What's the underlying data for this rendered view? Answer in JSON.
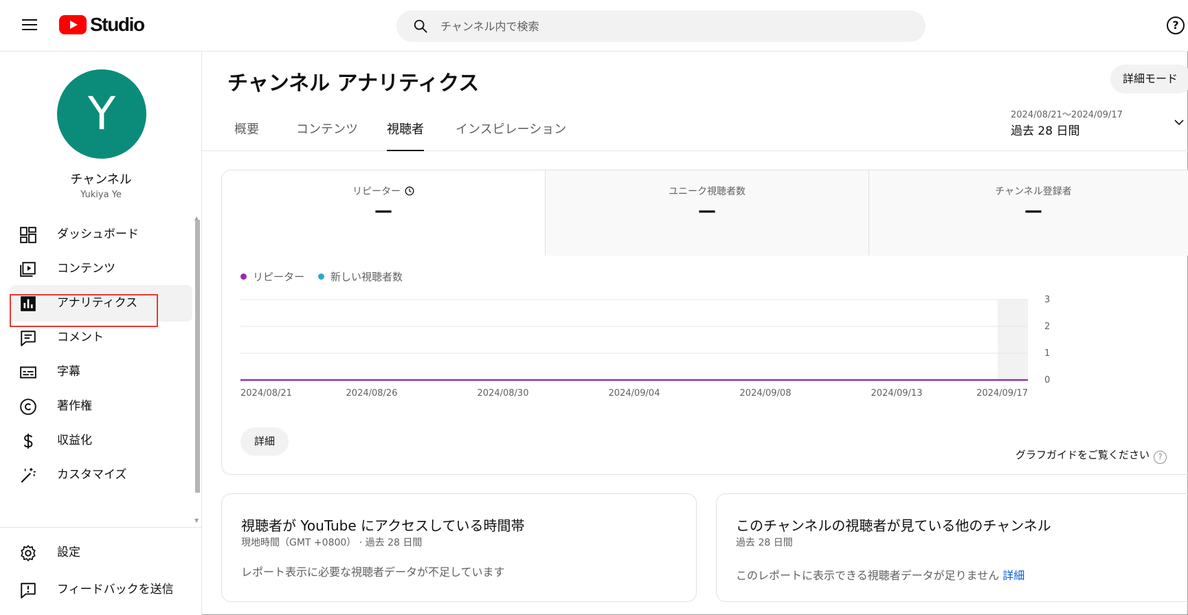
{
  "header": {
    "logo_text": "Studio",
    "search_placeholder": "チャンネル内で検索",
    "help_symbol": "?"
  },
  "channel": {
    "avatar_letter": "Y",
    "name": "チャンネル",
    "handle": "Yukiya Ye"
  },
  "sidebar": {
    "items": [
      {
        "label": "ダッシュボード",
        "icon": "dashboard-icon"
      },
      {
        "label": "コンテンツ",
        "icon": "content-icon"
      },
      {
        "label": "アナリティクス",
        "icon": "analytics-icon",
        "active": true
      },
      {
        "label": "コメント",
        "icon": "comments-icon"
      },
      {
        "label": "字幕",
        "icon": "subtitles-icon"
      },
      {
        "label": "著作権",
        "icon": "copyright-icon"
      },
      {
        "label": "収益化",
        "icon": "monetization-icon"
      },
      {
        "label": "カスタマイズ",
        "icon": "customization-icon"
      }
    ],
    "footer_items": [
      {
        "label": "設定",
        "icon": "settings-icon"
      },
      {
        "label": "フィードバックを送信",
        "icon": "feedback-icon"
      }
    ]
  },
  "page": {
    "title": "チャンネル アナリティクス",
    "mode_button": "詳細モード",
    "tabs": [
      "概要",
      "コンテンツ",
      "視聴者",
      "インスピレーション"
    ],
    "active_tab": "視聴者",
    "date_range": {
      "dates": "2024/08/21～2024/09/17",
      "label": "過去 28 日間"
    }
  },
  "metrics": [
    {
      "label": "リピーター",
      "value": "—"
    },
    {
      "label": "ユニーク視聴者数",
      "value": "—"
    },
    {
      "label": "チャンネル登録者",
      "value": "—"
    }
  ],
  "chart_data": {
    "type": "line",
    "x": [
      "2024/08/21",
      "2024/08/26",
      "2024/08/30",
      "2024/09/04",
      "2024/09/08",
      "2024/09/13",
      "2024/09/17"
    ],
    "series": [
      {
        "name": "リピーター",
        "color": "#9c27b0",
        "values": [
          0,
          0,
          0,
          0,
          0,
          0,
          0
        ]
      },
      {
        "name": "新しい視聴者数",
        "color": "#2ea7d1",
        "values": [
          0,
          0,
          0,
          0,
          0,
          0,
          0
        ]
      }
    ],
    "ylim": [
      0,
      3
    ],
    "yticks": [
      "0",
      "1",
      "2",
      "3"
    ],
    "grid": true,
    "legend_position": "top-left"
  },
  "chart_actions": {
    "detail_button": "詳細",
    "graph_guide": "グラフガイドをご覧ください"
  },
  "cards": [
    {
      "title": "視聴者が YouTube にアクセスしている時間帯",
      "subtitle": "現地時間（GMT +0800） · 過去 28 日間",
      "body": "レポート表示に必要な視聴者データが不足しています"
    },
    {
      "title": "このチャンネルの視聴者が見ている他のチャンネル",
      "subtitle": "過去 28 日間",
      "body": "このレポートに表示できる視聴者データが足りません",
      "link": "詳細"
    }
  ]
}
